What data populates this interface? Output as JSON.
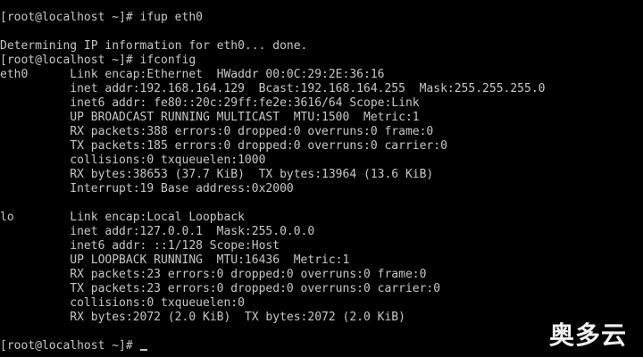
{
  "terminal": {
    "lines": [
      "[root@localhost ~]# ifup eth0",
      "",
      "Determining IP information for eth0... done.",
      "[root@localhost ~]# ifconfig",
      "eth0      Link encap:Ethernet  HWaddr 00:0C:29:2E:36:16",
      "          inet addr:192.168.164.129  Bcast:192.168.164.255  Mask:255.255.255.0",
      "          inet6 addr: fe80::20c:29ff:fe2e:3616/64 Scope:Link",
      "          UP BROADCAST RUNNING MULTICAST  MTU:1500  Metric:1",
      "          RX packets:388 errors:0 dropped:0 overruns:0 frame:0",
      "          TX packets:185 errors:0 dropped:0 overruns:0 carrier:0",
      "          collisions:0 txqueuelen:1000",
      "          RX bytes:38653 (37.7 KiB)  TX bytes:13964 (13.6 KiB)",
      "          Interrupt:19 Base address:0x2000",
      "",
      "lo        Link encap:Local Loopback",
      "          inet addr:127.0.0.1  Mask:255.0.0.0",
      "          inet6 addr: ::1/128 Scope:Host",
      "          UP LOOPBACK RUNNING  MTU:16436  Metric:1",
      "          RX packets:23 errors:0 dropped:0 overruns:0 frame:0",
      "          TX packets:23 errors:0 dropped:0 overruns:0 carrier:0",
      "          collisions:0 txqueuelen:0",
      "          RX bytes:2072 (2.0 KiB)  TX bytes:2072 (2.0 KiB)",
      "",
      "[root@localhost ~]# "
    ]
  },
  "watermark": {
    "text": "奥多云"
  },
  "colors": {
    "background": "#000000",
    "foreground": "#c7c7c7",
    "watermark": "#ffffff"
  }
}
